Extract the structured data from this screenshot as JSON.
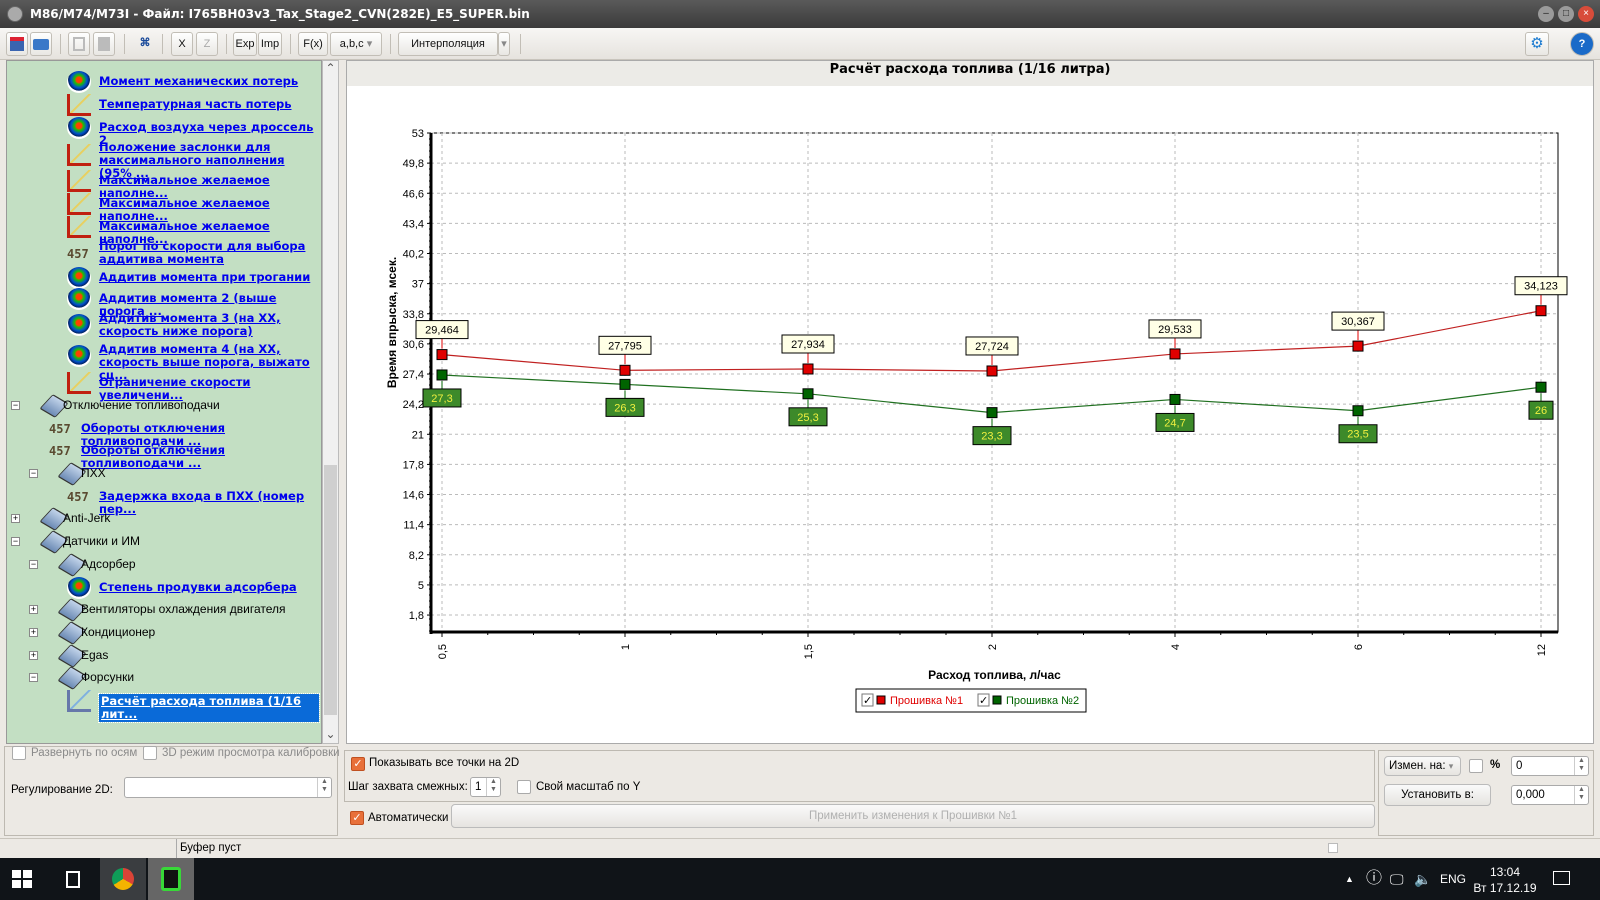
{
  "window": {
    "title": "M86/M74/M73I - Файл: I765BH03v3_Tax_Stage2_CVN(282E)_E5_SUPER.bin",
    "min": "–",
    "max": "□",
    "close": "×"
  },
  "toolbar": {
    "save": "save-icon",
    "open": "open-icon",
    "copy": "copy-icon",
    "paste": "paste-icon",
    "find": "binoculars-icon",
    "x": "X",
    "z": "Z",
    "exp": "Exp",
    "imp": "Imp",
    "fx": "F(x)",
    "abc": "a,b,c",
    "interp": "Интерполяция",
    "arrow": "▾",
    "settings": "⚙",
    "help": "?"
  },
  "tree": {
    "items": [
      {
        "level": 2,
        "icon": "surface",
        "label": "Момент механических потерь",
        "link": true,
        "lines": 1
      },
      {
        "level": 2,
        "icon": "curve",
        "label": "Температурная часть потерь",
        "link": true,
        "lines": 1
      },
      {
        "level": 2,
        "icon": "surface",
        "label": "Расход воздуха через дроссель 2",
        "link": true,
        "lines": 1
      },
      {
        "level": 2,
        "icon": "curve",
        "label": "Положение заслонки для максимального наполнения (95% ...",
        "link": true,
        "lines": 2
      },
      {
        "level": 2,
        "icon": "curve",
        "label": "Максимальное желаемое наполне...",
        "link": true,
        "lines": 1
      },
      {
        "level": 2,
        "icon": "curve",
        "label": "Максимальное желаемое наполне...",
        "link": true,
        "lines": 1
      },
      {
        "level": 2,
        "icon": "curve",
        "label": "Максимальное желаемое наполне...",
        "link": true,
        "lines": 1
      },
      {
        "level": 2,
        "icon": "num",
        "label": "Порог по скорости для выбора аддитива момента",
        "link": true,
        "lines": 2
      },
      {
        "level": 2,
        "icon": "surface",
        "label": "Аддитив момента при трогании",
        "link": true,
        "lines": 1,
        "h": 18
      },
      {
        "level": 2,
        "icon": "surface",
        "label": "Аддитив момента 2 (выше порога ...",
        "link": true,
        "lines": 1
      },
      {
        "level": 2,
        "icon": "surface",
        "label": "Аддитив момента 3 (на ХХ, скорость ниже порога)",
        "link": true,
        "lines": 2
      },
      {
        "level": 2,
        "icon": "surface",
        "label": "Аддитив момента 4 (на ХХ, скорость выше порога, выжато сц...",
        "link": true,
        "lines": 2
      },
      {
        "level": 2,
        "icon": "curve",
        "label": "Ограничение скорости увеличени...",
        "link": true,
        "lines": 1
      },
      {
        "level": 0,
        "icon": "folder",
        "label": "Отключение топливоподачи",
        "link": false,
        "exp": "−"
      },
      {
        "level": 1,
        "icon": "num",
        "label": "Обороты отключения топливоподачи ...",
        "link": true
      },
      {
        "level": 1,
        "icon": "num",
        "label": "Обороты отключения топливоподачи ...",
        "link": true
      },
      {
        "level": 1,
        "icon": "folder",
        "label": "ПХХ",
        "link": false,
        "exp": "−"
      },
      {
        "level": 2,
        "icon": "num",
        "label": "Задержка входа в ПХХ (номер пер...",
        "link": true
      },
      {
        "level": 0,
        "icon": "folder",
        "label": "Anti-Jerk",
        "link": false,
        "exp": "+"
      },
      {
        "level": 0,
        "icon": "folder",
        "label": "Датчики и ИМ",
        "link": false,
        "exp": "−"
      },
      {
        "level": 1,
        "icon": "folder",
        "label": "Адсорбер",
        "link": false,
        "exp": "−"
      },
      {
        "level": 2,
        "icon": "surface",
        "label": "Степень продувки адсорбера",
        "link": true
      },
      {
        "level": 1,
        "icon": "folder",
        "label": "Вентиляторы охлаждения двигателя",
        "link": false,
        "exp": "+"
      },
      {
        "level": 1,
        "icon": "folder",
        "label": "Кондиционер",
        "link": false,
        "exp": "+"
      },
      {
        "level": 1,
        "icon": "folder",
        "label": "Egas",
        "link": false,
        "exp": "+"
      },
      {
        "level": 1,
        "icon": "folder",
        "label": "Форсунки",
        "link": false,
        "exp": "−"
      },
      {
        "level": 2,
        "icon": "curve2",
        "label": "Расчёт расхода топлива (1/16 лит...",
        "link": true,
        "selected": true
      }
    ],
    "scroll_up": "⌃",
    "scroll_down": "⌄"
  },
  "chart_data": {
    "type": "line",
    "title": "Расчёт расхода топлива (1/16 литра)",
    "xlabel": "Расход топлива, л/час",
    "ylabel": "Время впрыска, мсек.",
    "categories": [
      "0,5",
      "1",
      "1,5",
      "2",
      "4",
      "6",
      "12"
    ],
    "ylim": [
      0,
      53
    ],
    "yticks": [
      "53",
      "49,8",
      "46,6",
      "43,4",
      "40,2",
      "37",
      "33,8",
      "30,6",
      "27,4",
      "24,2",
      "21",
      "17,8",
      "14,6",
      "11,4",
      "8,2",
      "5",
      "1,8"
    ],
    "ytick_values": [
      53,
      49.8,
      46.6,
      43.4,
      40.2,
      37,
      33.8,
      30.6,
      27.4,
      24.2,
      21,
      17.8,
      14.6,
      11.4,
      8.2,
      5,
      1.8
    ],
    "grid": true,
    "legend_position": "bottom-center",
    "series": [
      {
        "name": "Прошивка №1",
        "color": "#e00000",
        "line": "#c02020",
        "values": [
          29.464,
          27.795,
          27.934,
          27.724,
          29.533,
          30.367,
          34.123
        ],
        "labels": [
          "29,464",
          "27,795",
          "27,934",
          "27,724",
          "29,533",
          "30,367",
          "34,123"
        ]
      },
      {
        "name": "Прошивка №2",
        "color": "#006400",
        "line": "#207020",
        "values": [
          27.3,
          26.3,
          25.3,
          23.3,
          24.7,
          23.5,
          26
        ],
        "labels": [
          "27,3",
          "26,3",
          "25,3",
          "23,3",
          "24,7",
          "23,5",
          "26"
        ]
      }
    ]
  },
  "bottom": {
    "expand_axes": "Развернуть по осям",
    "mode3d": "3D режим просмотра калибровки",
    "reg2d_label": "Регулирование 2D:",
    "reg2d_value": "",
    "show_all_points": "Показывать все точки на 2D",
    "step_label": "Шаг захвата смежных:",
    "step_value": "1",
    "own_scale": "Свой масштаб по Y",
    "auto": "Автоматически",
    "apply": "Применить изменения к Прошивки №1",
    "change_by": "Измен. на:",
    "percent": "%",
    "change_value": "0",
    "set_to": "Установить в:",
    "set_value": "0,000",
    "check": "✓"
  },
  "status": {
    "buffer": "Буфер пуст"
  },
  "taskbar": {
    "lang": "ENG",
    "time": "13:04",
    "date": "Вт 17.12.19"
  }
}
